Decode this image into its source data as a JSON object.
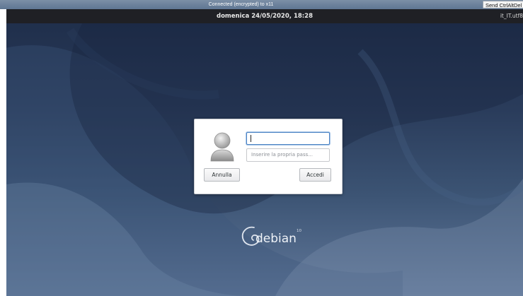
{
  "vnc": {
    "status": "Connected (encrypted) to x11",
    "send_cad_label": "Send CtrlAltDel"
  },
  "panel": {
    "clock": "domenica 24/05/2020, 18:28",
    "locale": "it_IT.utf8"
  },
  "login": {
    "username_value": "",
    "password_placeholder": "Inserire la propria pass...",
    "cancel_label": "Annulla",
    "login_label": "Accedi"
  },
  "branding": {
    "logo_text": "debian",
    "logo_version": "10"
  },
  "colors": {
    "background_top": "#1e2d49",
    "background_bottom": "#61789a",
    "panel": "#1f2025",
    "focus_border": "#4d84c4"
  }
}
